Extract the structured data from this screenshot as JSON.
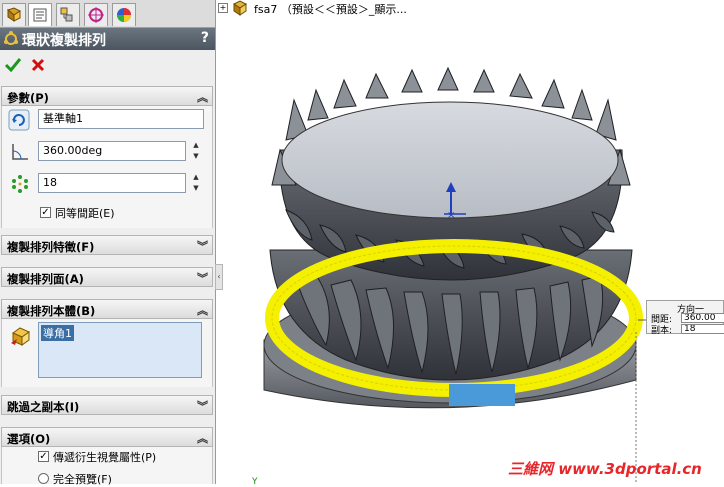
{
  "panel": {
    "title": "環狀複製排列",
    "help": "?",
    "ok_icon": "check-icon",
    "cancel_icon": "x-icon"
  },
  "tabs": [
    {
      "name": "feature-manager-icon"
    },
    {
      "name": "property-manager-icon"
    },
    {
      "name": "configuration-manager-icon"
    },
    {
      "name": "dimxpert-manager-icon"
    },
    {
      "name": "display-manager-icon"
    }
  ],
  "parameters": {
    "header": "參數(P)",
    "axis_value": "基準軸1",
    "angle_value": "360.00deg",
    "count_value": "18",
    "equal_spacing_label": "同等間距(E)",
    "equal_spacing_checked": true
  },
  "sections": {
    "features_header": "複製排列特徵(F)",
    "faces_header": "複製排列面(A)",
    "bodies_header": "複製排列本體(B)",
    "bodies_item": "導角1",
    "skip_header": "跳過之副本(I)",
    "options_header": "選項(O)",
    "option1_label": "傳遞衍生視覺屬性(P)",
    "option1_checked": true,
    "option2_label": "完全預覽(F)",
    "option2_checked": false
  },
  "tree": {
    "expand": "+",
    "label": "fsa7 （預設＜＜預設＞_顯示..."
  },
  "callout": {
    "title": "方向一",
    "spacing_label": "間距:",
    "spacing_value": "360.00",
    "copies_label": "副本:",
    "copies_value": "18"
  },
  "watermark": "三維网 www.3dportal.cn",
  "colors": {
    "selection_highlight": "#f5f000",
    "model_gray": "#8a8d92",
    "accent_blue": "#1f3fbf"
  }
}
